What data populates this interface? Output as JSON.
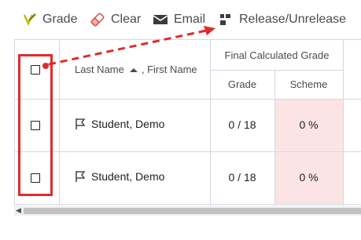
{
  "toolbar": {
    "grade_label": "Grade",
    "clear_label": "Clear",
    "email_label": "Email",
    "release_label": "Release/Unrelease"
  },
  "table": {
    "name_header": "Last Name",
    "name_header_secondary": ", First Name",
    "group_header": "Final Calculated Grade",
    "grade_header": "Grade",
    "scheme_header": "Scheme",
    "rows": [
      {
        "name": "Student, Demo",
        "grade": "0 / 18",
        "scheme": "0 %"
      },
      {
        "name": "Student, Demo",
        "grade": "0 / 18",
        "scheme": "0 %"
      }
    ]
  },
  "colors": {
    "annotation_red": "#e02b2b",
    "scheme_cell_bg": "#fce4e4"
  },
  "icons": [
    "grade-icon",
    "eraser-icon",
    "envelope-icon",
    "release-icon",
    "sort-up-icon",
    "flag-icon",
    "scroll-left-icon"
  ]
}
